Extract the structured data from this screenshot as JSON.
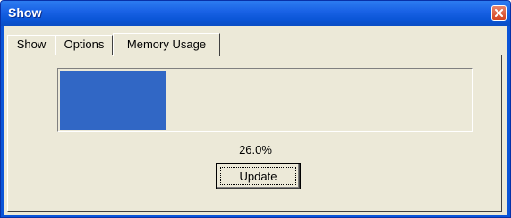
{
  "window": {
    "title": "Show"
  },
  "tabs": [
    {
      "label": "Show",
      "active": false
    },
    {
      "label": "Options",
      "active": false
    },
    {
      "label": "Memory Usage",
      "active": true
    }
  ],
  "memory": {
    "progress_fraction": 0.26,
    "percent_text": "26.0%",
    "fill_color": "#3167c5"
  },
  "buttons": {
    "update_label": "Update"
  },
  "icons": {
    "close": "close-icon"
  }
}
